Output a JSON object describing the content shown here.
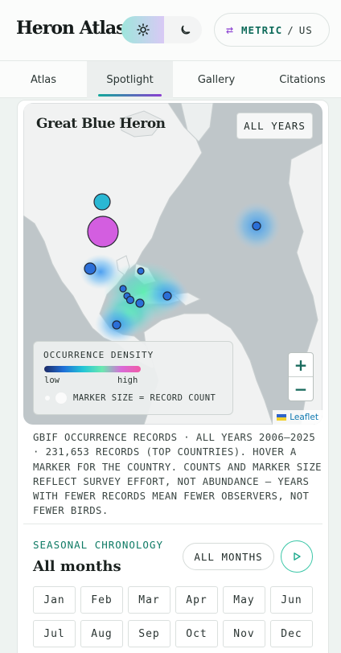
{
  "header": {
    "brand": "Heron Atlas",
    "theme": {
      "light_icon": "sun-icon",
      "dark_icon": "moon-icon",
      "active": "light"
    },
    "units": {
      "icon": "swap-arrows-icon",
      "metric": "METRIC",
      "separator": "/",
      "us": "US",
      "active": "METRIC"
    }
  },
  "tabs": [
    {
      "label": "Atlas"
    },
    {
      "label": "Spotlight",
      "active": true
    },
    {
      "label": "Gallery"
    },
    {
      "label": "Citations"
    }
  ],
  "map": {
    "species_title": "Great Blue Heron",
    "years_chip": "ALL YEARS",
    "legend": {
      "title": "OCCURRENCE DENSITY",
      "low": "low",
      "high": "high",
      "marker_note": "MARKER SIZE = RECORD COUNT"
    },
    "zoom_in": "+",
    "zoom_out": "−",
    "attribution": "Leaflet",
    "colors": {
      "marker_large": "#d35ee0",
      "marker_medium": "#2ab8d4",
      "marker_small": "#2b6fd8"
    }
  },
  "description": "GBIF OCCURRENCE RECORDS · ALL YEARS 2006–2025 · 231,653 RECORDS (TOP COUNTRIES). HOVER A MARKER FOR THE COUNTRY. COUNTS AND MARKER SIZE REFLECT SURVEY EFFORT, NOT ABUNDANCE — YEARS WITH FEWER RECORDS MEAN FEWER OBSERVERS, NOT FEWER BIRDS.",
  "chronology": {
    "eyebrow": "SEASONAL CHRONOLOGY",
    "title": "All months",
    "all_button": "ALL MONTHS",
    "play_icon": "play-icon",
    "months": [
      "Jan",
      "Feb",
      "Mar",
      "Apr",
      "May",
      "Jun",
      "Jul",
      "Aug",
      "Sep",
      "Oct",
      "Nov",
      "Dec"
    ]
  }
}
